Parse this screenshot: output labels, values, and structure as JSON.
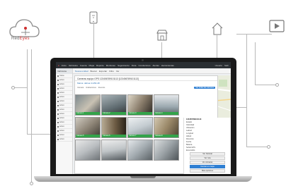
{
  "brand": {
    "name": "Red",
    "name_accent": "Eyes"
  },
  "app": {
    "top_menu": [
      "Inicio",
      "Vehículos",
      "Cuenta",
      "Mapa",
      "Reporte",
      "Monitoreo",
      "Seguimiento",
      "Flota",
      "Conductores",
      "Alertas",
      "Herramientas",
      "Soporte",
      "Ayuda"
    ],
    "top_right": [
      "Usuario",
      "Salir"
    ],
    "sidebar_head": "Vehículos",
    "sidebar_items": [
      "Todos",
      "Activo",
      "Activo",
      "Activo",
      "Activo",
      "Activo",
      "Activo",
      "Activo",
      "Activo",
      "Activo",
      "Activo",
      "Activo",
      "Activo",
      "Activo",
      "Activo",
      "Activo"
    ],
    "content_bar": [
      "Nueva unidad",
      "Buscar",
      "Exportar",
      "Filtro",
      "Ver"
    ],
    "panel_title": "Cameras equipo GPS 123456789101113 [123456789101113]",
    "panel_subtitle": "Marca: dahua /LG50-48",
    "tabs": [
      "Cámara",
      "Grabaciones",
      "Eventos"
    ],
    "tab_button": "Ver todas las cámaras",
    "camera_labels": [
      "Cámara 1",
      "Cámara 2",
      "Cámara 3",
      "Cámara 4",
      "Cámara 5",
      "Cámara 6",
      "Cámara 7",
      "Cámara 8"
    ],
    "details": {
      "id": "123456789101113",
      "rows": [
        "Estado",
        "Velocidad",
        "Ubicación",
        "Latitud",
        "Longitud",
        "Altitud",
        "Dirección",
        "Fecha",
        "Batería",
        "Señal GPS",
        "Encendido"
      ],
      "buttons": [
        "Ver historial",
        "Ver ruta",
        "Ver cámaras",
        "Centrar en mapa",
        "Más opciones"
      ]
    }
  }
}
